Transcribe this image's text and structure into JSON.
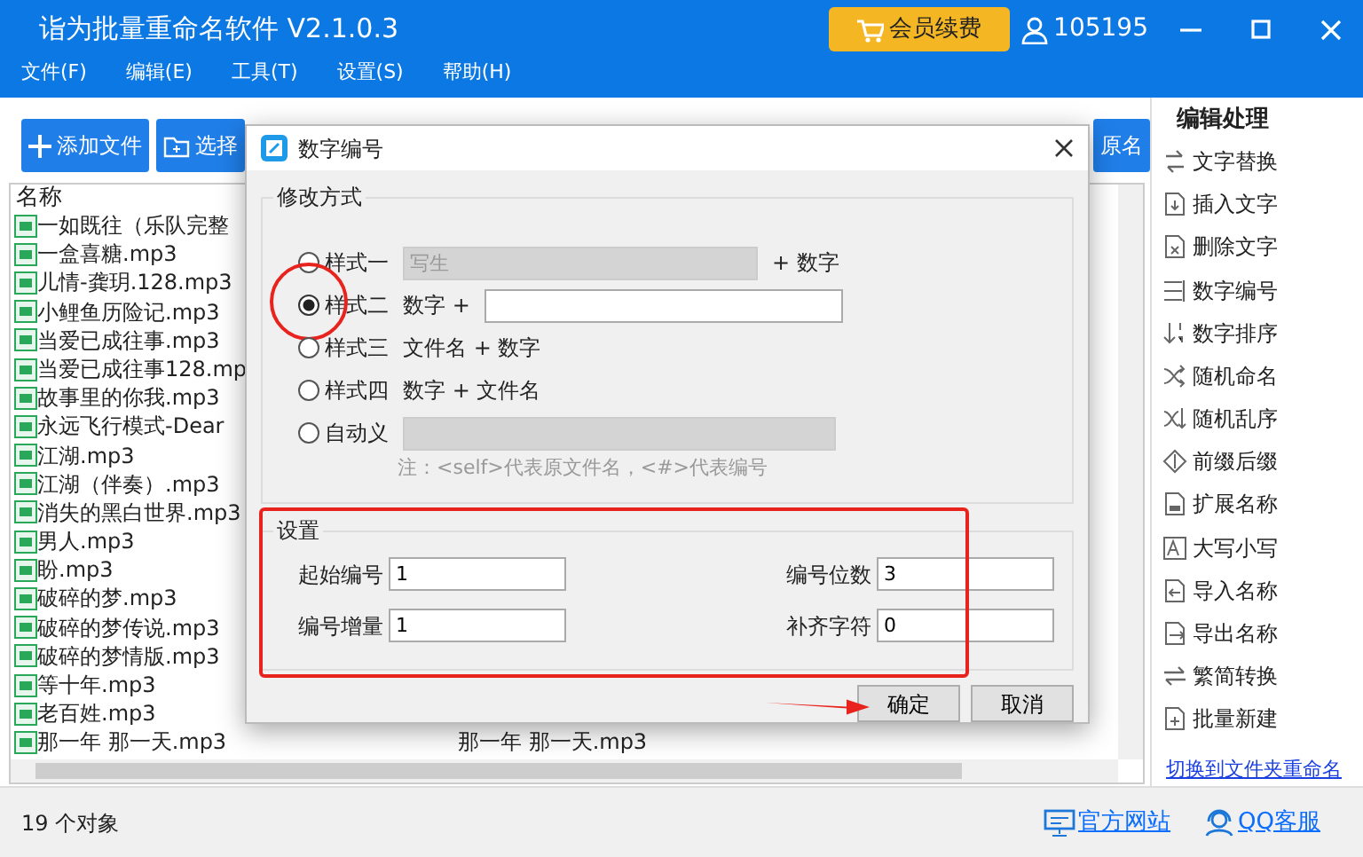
{
  "window": {
    "title": "诣为批量重命名软件 V2.1.0.3",
    "vip_button": "会员续费",
    "user_id": "105195"
  },
  "menu": [
    "文件(F)",
    "编辑(E)",
    "工具(T)",
    "设置(S)",
    "帮助(H)"
  ],
  "toolbar": [
    {
      "label": "添加文件",
      "kind": "add"
    },
    {
      "label": "选择",
      "kind": "folder"
    },
    {
      "label": "原名",
      "kind": "plain"
    }
  ],
  "file_list": {
    "columns": [
      "名称"
    ],
    "rows": [
      {
        "name": "一如既往（乐队完整"
      },
      {
        "name": "一盒喜糖.mp3"
      },
      {
        "name": "儿情-龚玥.128.mp3"
      },
      {
        "name": "小鲤鱼历险记.mp3"
      },
      {
        "name": "当爱已成往事.mp3"
      },
      {
        "name": "当爱已成往事128.mp"
      },
      {
        "name": "故事里的你我.mp3"
      },
      {
        "name": "永远飞行模式-Dear"
      },
      {
        "name": "江湖.mp3"
      },
      {
        "name": "江湖（伴奏）.mp3"
      },
      {
        "name": "消失的黑白世界.mp3"
      },
      {
        "name": "男人.mp3"
      },
      {
        "name": "盼.mp3"
      },
      {
        "name": "破碎的梦.mp3"
      },
      {
        "name": "破碎的梦传说.mp3"
      },
      {
        "name": "破碎的梦情版.mp3"
      },
      {
        "name": "等十年.mp3"
      },
      {
        "name": "老百姓.mp3"
      },
      {
        "name": "那一年 那一天.mp3",
        "column_2": "那一年 那一天.mp3"
      }
    ]
  },
  "side_panel": {
    "title": "编辑处理",
    "items": [
      "文字替换",
      "插入文字",
      "删除文字",
      "数字编号",
      "数字排序",
      "随机命名",
      "随机乱序",
      "前缀后缀",
      "扩展名称",
      "大写小写",
      "导入名称",
      "导出名称",
      "繁简转换",
      "批量新建"
    ],
    "link": "切换到文件夹重命名"
  },
  "status_bar": {
    "count": "19 个对象",
    "links": [
      {
        "label": "官方网站",
        "kind": "monitor"
      },
      {
        "label": "QQ客服",
        "kind": "support"
      }
    ]
  },
  "dialog": {
    "title": "数字编号",
    "mode_group": {
      "title": "修改方式",
      "options": [
        {
          "label": "样式一",
          "selected": false,
          "circled": false,
          "parts": [
            {
              "kind": "field",
              "value": "写生",
              "disabled": true
            },
            {
              "kind": "text",
              "text": "+ 数字"
            }
          ]
        },
        {
          "label": "样式二",
          "selected": true,
          "circled": true,
          "parts": [
            {
              "kind": "text",
              "text": "数字 +"
            },
            {
              "kind": "field",
              "disabled": false
            }
          ]
        },
        {
          "label": "样式三",
          "selected": false,
          "circled": false,
          "parts": [
            {
              "kind": "text",
              "text": "文件名 + 数字"
            }
          ]
        },
        {
          "label": "样式四",
          "selected": false,
          "circled": false,
          "parts": [
            {
              "kind": "text",
              "text": "数字 + 文件名"
            }
          ]
        },
        {
          "label": "自动义",
          "selected": false,
          "circled": false,
          "parts": [
            {
              "kind": "field",
              "disabled": true
            }
          ]
        }
      ],
      "note": "注：<self>代表原文件名，<#>代表编号"
    },
    "settings_group": {
      "title": "设置",
      "framed": true,
      "fields": [
        {
          "label": "起始编号",
          "value": "1"
        },
        {
          "label": "编号位数",
          "value": "3"
        },
        {
          "label": "编号增量",
          "value": "1"
        },
        {
          "label": "补齐字符",
          "value": "0"
        }
      ]
    },
    "buttons": [
      {
        "label": "确定",
        "pointed": true
      },
      {
        "label": "取消",
        "pointed": false
      }
    ]
  }
}
